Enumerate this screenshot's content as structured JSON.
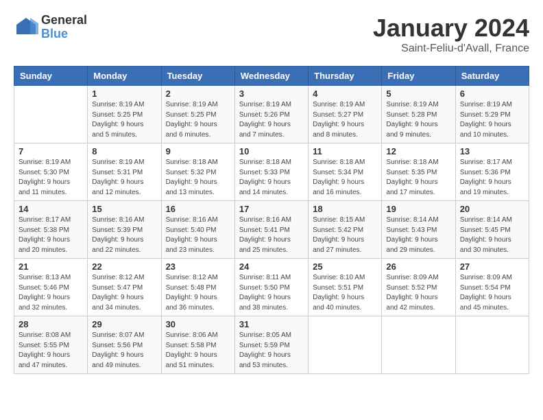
{
  "header": {
    "logo_general": "General",
    "logo_blue": "Blue",
    "month_title": "January 2024",
    "location": "Saint-Feliu-d'Avall, France"
  },
  "days_of_week": [
    "Sunday",
    "Monday",
    "Tuesday",
    "Wednesday",
    "Thursday",
    "Friday",
    "Saturday"
  ],
  "weeks": [
    [
      {
        "num": "",
        "sunrise": "",
        "sunset": "",
        "daylight": ""
      },
      {
        "num": "1",
        "sunrise": "Sunrise: 8:19 AM",
        "sunset": "Sunset: 5:25 PM",
        "daylight": "Daylight: 9 hours and 5 minutes."
      },
      {
        "num": "2",
        "sunrise": "Sunrise: 8:19 AM",
        "sunset": "Sunset: 5:25 PM",
        "daylight": "Daylight: 9 hours and 6 minutes."
      },
      {
        "num": "3",
        "sunrise": "Sunrise: 8:19 AM",
        "sunset": "Sunset: 5:26 PM",
        "daylight": "Daylight: 9 hours and 7 minutes."
      },
      {
        "num": "4",
        "sunrise": "Sunrise: 8:19 AM",
        "sunset": "Sunset: 5:27 PM",
        "daylight": "Daylight: 9 hours and 8 minutes."
      },
      {
        "num": "5",
        "sunrise": "Sunrise: 8:19 AM",
        "sunset": "Sunset: 5:28 PM",
        "daylight": "Daylight: 9 hours and 9 minutes."
      },
      {
        "num": "6",
        "sunrise": "Sunrise: 8:19 AM",
        "sunset": "Sunset: 5:29 PM",
        "daylight": "Daylight: 9 hours and 10 minutes."
      }
    ],
    [
      {
        "num": "7",
        "sunrise": "Sunrise: 8:19 AM",
        "sunset": "Sunset: 5:30 PM",
        "daylight": "Daylight: 9 hours and 11 minutes."
      },
      {
        "num": "8",
        "sunrise": "Sunrise: 8:19 AM",
        "sunset": "Sunset: 5:31 PM",
        "daylight": "Daylight: 9 hours and 12 minutes."
      },
      {
        "num": "9",
        "sunrise": "Sunrise: 8:18 AM",
        "sunset": "Sunset: 5:32 PM",
        "daylight": "Daylight: 9 hours and 13 minutes."
      },
      {
        "num": "10",
        "sunrise": "Sunrise: 8:18 AM",
        "sunset": "Sunset: 5:33 PM",
        "daylight": "Daylight: 9 hours and 14 minutes."
      },
      {
        "num": "11",
        "sunrise": "Sunrise: 8:18 AM",
        "sunset": "Sunset: 5:34 PM",
        "daylight": "Daylight: 9 hours and 16 minutes."
      },
      {
        "num": "12",
        "sunrise": "Sunrise: 8:18 AM",
        "sunset": "Sunset: 5:35 PM",
        "daylight": "Daylight: 9 hours and 17 minutes."
      },
      {
        "num": "13",
        "sunrise": "Sunrise: 8:17 AM",
        "sunset": "Sunset: 5:36 PM",
        "daylight": "Daylight: 9 hours and 19 minutes."
      }
    ],
    [
      {
        "num": "14",
        "sunrise": "Sunrise: 8:17 AM",
        "sunset": "Sunset: 5:38 PM",
        "daylight": "Daylight: 9 hours and 20 minutes."
      },
      {
        "num": "15",
        "sunrise": "Sunrise: 8:16 AM",
        "sunset": "Sunset: 5:39 PM",
        "daylight": "Daylight: 9 hours and 22 minutes."
      },
      {
        "num": "16",
        "sunrise": "Sunrise: 8:16 AM",
        "sunset": "Sunset: 5:40 PM",
        "daylight": "Daylight: 9 hours and 23 minutes."
      },
      {
        "num": "17",
        "sunrise": "Sunrise: 8:16 AM",
        "sunset": "Sunset: 5:41 PM",
        "daylight": "Daylight: 9 hours and 25 minutes."
      },
      {
        "num": "18",
        "sunrise": "Sunrise: 8:15 AM",
        "sunset": "Sunset: 5:42 PM",
        "daylight": "Daylight: 9 hours and 27 minutes."
      },
      {
        "num": "19",
        "sunrise": "Sunrise: 8:14 AM",
        "sunset": "Sunset: 5:43 PM",
        "daylight": "Daylight: 9 hours and 29 minutes."
      },
      {
        "num": "20",
        "sunrise": "Sunrise: 8:14 AM",
        "sunset": "Sunset: 5:45 PM",
        "daylight": "Daylight: 9 hours and 30 minutes."
      }
    ],
    [
      {
        "num": "21",
        "sunrise": "Sunrise: 8:13 AM",
        "sunset": "Sunset: 5:46 PM",
        "daylight": "Daylight: 9 hours and 32 minutes."
      },
      {
        "num": "22",
        "sunrise": "Sunrise: 8:12 AM",
        "sunset": "Sunset: 5:47 PM",
        "daylight": "Daylight: 9 hours and 34 minutes."
      },
      {
        "num": "23",
        "sunrise": "Sunrise: 8:12 AM",
        "sunset": "Sunset: 5:48 PM",
        "daylight": "Daylight: 9 hours and 36 minutes."
      },
      {
        "num": "24",
        "sunrise": "Sunrise: 8:11 AM",
        "sunset": "Sunset: 5:50 PM",
        "daylight": "Daylight: 9 hours and 38 minutes."
      },
      {
        "num": "25",
        "sunrise": "Sunrise: 8:10 AM",
        "sunset": "Sunset: 5:51 PM",
        "daylight": "Daylight: 9 hours and 40 minutes."
      },
      {
        "num": "26",
        "sunrise": "Sunrise: 8:09 AM",
        "sunset": "Sunset: 5:52 PM",
        "daylight": "Daylight: 9 hours and 42 minutes."
      },
      {
        "num": "27",
        "sunrise": "Sunrise: 8:09 AM",
        "sunset": "Sunset: 5:54 PM",
        "daylight": "Daylight: 9 hours and 45 minutes."
      }
    ],
    [
      {
        "num": "28",
        "sunrise": "Sunrise: 8:08 AM",
        "sunset": "Sunset: 5:55 PM",
        "daylight": "Daylight: 9 hours and 47 minutes."
      },
      {
        "num": "29",
        "sunrise": "Sunrise: 8:07 AM",
        "sunset": "Sunset: 5:56 PM",
        "daylight": "Daylight: 9 hours and 49 minutes."
      },
      {
        "num": "30",
        "sunrise": "Sunrise: 8:06 AM",
        "sunset": "Sunset: 5:58 PM",
        "daylight": "Daylight: 9 hours and 51 minutes."
      },
      {
        "num": "31",
        "sunrise": "Sunrise: 8:05 AM",
        "sunset": "Sunset: 5:59 PM",
        "daylight": "Daylight: 9 hours and 53 minutes."
      },
      {
        "num": "",
        "sunrise": "",
        "sunset": "",
        "daylight": ""
      },
      {
        "num": "",
        "sunrise": "",
        "sunset": "",
        "daylight": ""
      },
      {
        "num": "",
        "sunrise": "",
        "sunset": "",
        "daylight": ""
      }
    ]
  ]
}
